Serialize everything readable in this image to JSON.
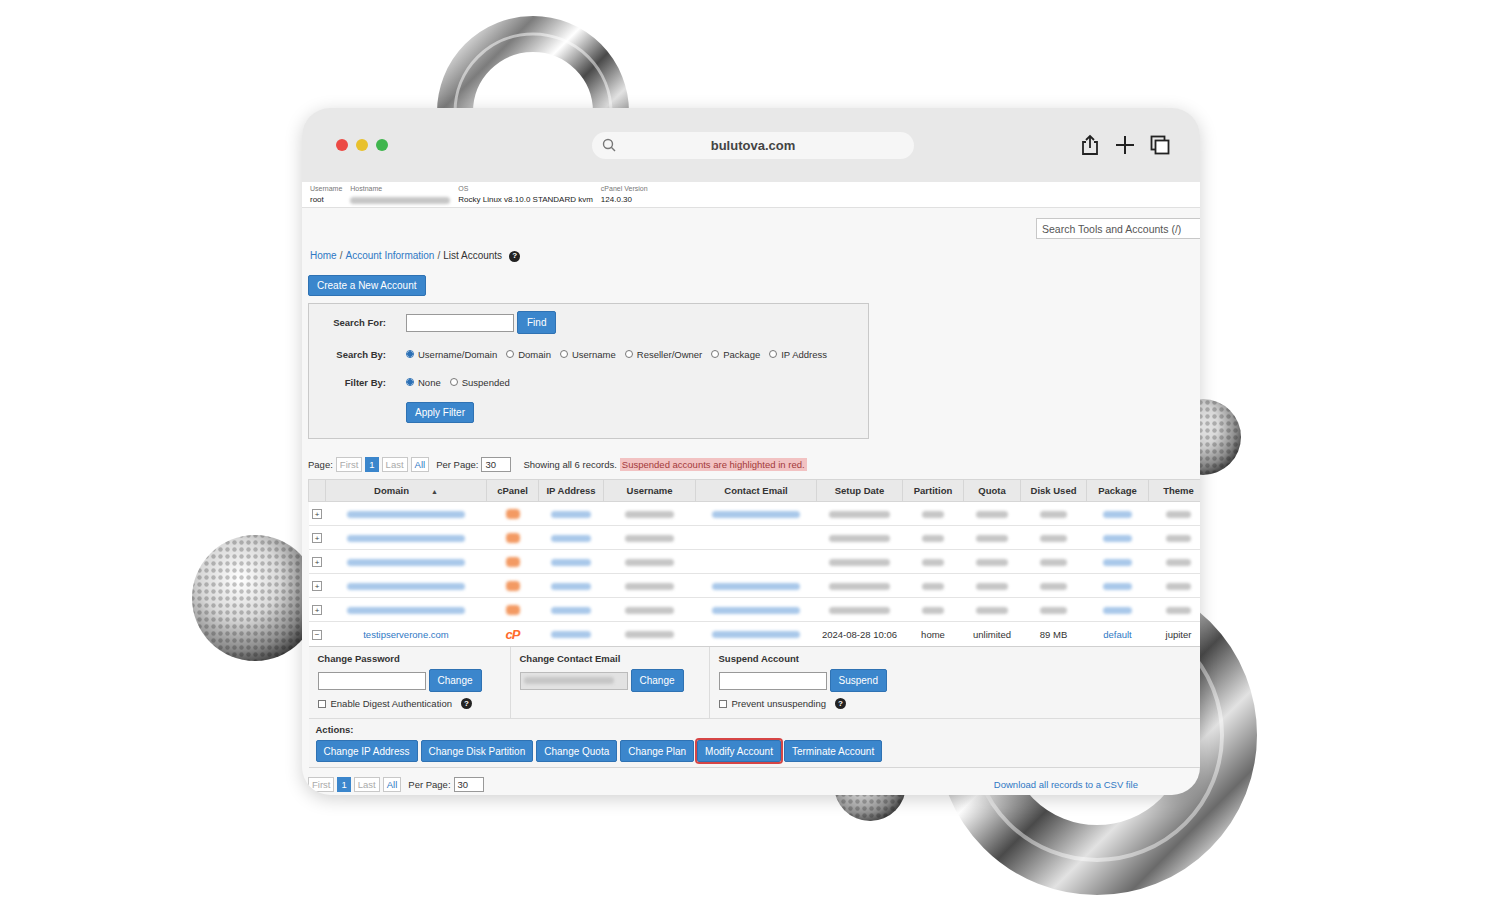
{
  "browser": {
    "url": "bulutova.com"
  },
  "info": [
    {
      "label": "Username",
      "value": "root",
      "blurred": false
    },
    {
      "label": "Hostname",
      "value": "",
      "blurred": true
    },
    {
      "label": "OS",
      "value": "Rocky Linux v8.10.0 STANDARD kvm",
      "blurred": false
    },
    {
      "label": "cPanel Version",
      "value": "124.0.30",
      "blurred": false
    }
  ],
  "global_search": {
    "placeholder": "Search Tools and Accounts (/)",
    "value": ""
  },
  "breadcrumb": {
    "separator": "/",
    "help_icon": "?",
    "items": [
      {
        "label": "Home",
        "link": true
      },
      {
        "label": "Account Information",
        "link": true
      },
      {
        "label": "List Accounts",
        "link": false
      }
    ]
  },
  "create_button": "Create a New Account",
  "search_panel": {
    "search_for_label": "Search For:",
    "search_value": "",
    "find_button": "Find",
    "search_by_label": "Search By:",
    "search_by": [
      {
        "label": "Username/Domain",
        "selected": true
      },
      {
        "label": "Domain",
        "selected": false
      },
      {
        "label": "Username",
        "selected": false
      },
      {
        "label": "Reseller/Owner",
        "selected": false
      },
      {
        "label": "Package",
        "selected": false
      },
      {
        "label": "IP Address",
        "selected": false
      }
    ],
    "filter_by_label": "Filter By:",
    "filter_by": [
      {
        "label": "None",
        "selected": true
      },
      {
        "label": "Suspended",
        "selected": false
      }
    ],
    "apply_button": "Apply Filter"
  },
  "pagination": {
    "page_label": "Page:",
    "pages": [
      {
        "label": "First",
        "selected": false,
        "disabled": true
      },
      {
        "label": "1",
        "selected": true,
        "disabled": false
      },
      {
        "label": "Last",
        "selected": false,
        "disabled": true
      },
      {
        "label": "All",
        "selected": false,
        "disabled": false
      }
    ],
    "per_page_label": "Per Page:",
    "per_page": "30",
    "summary": "Showing all 6 records.",
    "suspended_note": "Suspended accounts are highlighted in red."
  },
  "table": {
    "columns": [
      {
        "label": "Domain",
        "sorted": true,
        "sort_icon": "▲"
      },
      {
        "label": "cPanel",
        "sorted": false
      },
      {
        "label": "IP Address",
        "sorted": false
      },
      {
        "label": "Username",
        "sorted": false
      },
      {
        "label": "Contact Email",
        "sorted": false
      },
      {
        "label": "Setup Date",
        "sorted": false
      },
      {
        "label": "Partition",
        "sorted": false
      },
      {
        "label": "Quota",
        "sorted": false
      },
      {
        "label": "Disk Used",
        "sorted": false
      },
      {
        "label": "Package",
        "sorted": false
      },
      {
        "label": "Theme",
        "sorted": false
      }
    ],
    "rows": [
      {
        "expanded": false,
        "expand_icon": "+",
        "cells": [
          {
            "kind": "link",
            "text": "",
            "blurred": true
          },
          {
            "kind": "logo",
            "text": "",
            "blurred": true
          },
          {
            "kind": "link",
            "text": "",
            "blurred": true
          },
          {
            "kind": "text",
            "text": "",
            "blurred": true
          },
          {
            "kind": "link",
            "text": "",
            "blurred": true
          },
          {
            "kind": "text",
            "text": "",
            "blurred": true
          },
          {
            "kind": "text",
            "text": "",
            "blurred": true
          },
          {
            "kind": "text",
            "text": "",
            "blurred": true
          },
          {
            "kind": "text",
            "text": "",
            "blurred": true
          },
          {
            "kind": "link",
            "text": "",
            "blurred": true
          },
          {
            "kind": "text",
            "text": "",
            "blurred": true
          }
        ]
      },
      {
        "expanded": false,
        "expand_icon": "+",
        "cells": [
          {
            "kind": "link",
            "text": "",
            "blurred": true
          },
          {
            "kind": "logo",
            "text": "",
            "blurred": true
          },
          {
            "kind": "link",
            "text": "",
            "blurred": true
          },
          {
            "kind": "text",
            "text": "",
            "blurred": true
          },
          {
            "kind": "empty",
            "text": "",
            "blurred": false
          },
          {
            "kind": "text",
            "text": "",
            "blurred": true
          },
          {
            "kind": "text",
            "text": "",
            "blurred": true
          },
          {
            "kind": "text",
            "text": "",
            "blurred": true
          },
          {
            "kind": "text",
            "text": "",
            "blurred": true
          },
          {
            "kind": "link",
            "text": "",
            "blurred": true
          },
          {
            "kind": "text",
            "text": "",
            "blurred": true
          }
        ]
      },
      {
        "expanded": false,
        "expand_icon": "+",
        "cells": [
          {
            "kind": "link",
            "text": "",
            "blurred": true
          },
          {
            "kind": "logo",
            "text": "",
            "blurred": true
          },
          {
            "kind": "link",
            "text": "",
            "blurred": true
          },
          {
            "kind": "text",
            "text": "",
            "blurred": true
          },
          {
            "kind": "empty",
            "text": "",
            "blurred": false
          },
          {
            "kind": "text",
            "text": "",
            "blurred": true
          },
          {
            "kind": "text",
            "text": "",
            "blurred": true
          },
          {
            "kind": "text",
            "text": "",
            "blurred": true
          },
          {
            "kind": "text",
            "text": "",
            "blurred": true
          },
          {
            "kind": "link",
            "text": "",
            "blurred": true
          },
          {
            "kind": "text",
            "text": "",
            "blurred": true
          }
        ]
      },
      {
        "expanded": false,
        "expand_icon": "+",
        "cells": [
          {
            "kind": "link",
            "text": "",
            "blurred": true
          },
          {
            "kind": "logo",
            "text": "",
            "blurred": true
          },
          {
            "kind": "link",
            "text": "",
            "blurred": true
          },
          {
            "kind": "text",
            "text": "",
            "blurred": true
          },
          {
            "kind": "link",
            "text": "",
            "blurred": true
          },
          {
            "kind": "text",
            "text": "",
            "blurred": true
          },
          {
            "kind": "text",
            "text": "",
            "blurred": true
          },
          {
            "kind": "text",
            "text": "",
            "blurred": true
          },
          {
            "kind": "text",
            "text": "",
            "blurred": true
          },
          {
            "kind": "link",
            "text": "",
            "blurred": true
          },
          {
            "kind": "text",
            "text": "",
            "blurred": true
          }
        ]
      },
      {
        "expanded": false,
        "expand_icon": "+",
        "cells": [
          {
            "kind": "link",
            "text": "",
            "blurred": true
          },
          {
            "kind": "logo",
            "text": "",
            "blurred": true
          },
          {
            "kind": "link",
            "text": "",
            "blurred": true
          },
          {
            "kind": "text",
            "text": "",
            "blurred": true
          },
          {
            "kind": "link",
            "text": "",
            "blurred": true
          },
          {
            "kind": "text",
            "text": "",
            "blurred": true
          },
          {
            "kind": "text",
            "text": "",
            "blurred": true
          },
          {
            "kind": "text",
            "text": "",
            "blurred": true
          },
          {
            "kind": "text",
            "text": "",
            "blurred": true
          },
          {
            "kind": "link",
            "text": "",
            "blurred": true
          },
          {
            "kind": "text",
            "text": "",
            "blurred": true
          }
        ]
      },
      {
        "expanded": true,
        "expand_icon": "−",
        "cells": [
          {
            "kind": "link",
            "text": "testipserverone.com",
            "blurred": false
          },
          {
            "kind": "logo",
            "text": "cP",
            "blurred": false
          },
          {
            "kind": "link",
            "text": "",
            "blurred": true
          },
          {
            "kind": "text",
            "text": "",
            "blurred": true
          },
          {
            "kind": "link",
            "text": "",
            "blurred": true
          },
          {
            "kind": "text",
            "text": "2024-08-28 10:06",
            "blurred": false
          },
          {
            "kind": "text",
            "text": "home",
            "blurred": false
          },
          {
            "kind": "text",
            "text": "unlimited",
            "blurred": false
          },
          {
            "kind": "text",
            "text": "89 MB",
            "blurred": false
          },
          {
            "kind": "link",
            "text": "default",
            "blurred": false
          },
          {
            "kind": "text",
            "text": "jupiter",
            "blurred": false
          }
        ]
      }
    ]
  },
  "account_panel": {
    "sections": [
      {
        "title": "Change Password",
        "input": "",
        "input_blurred": false,
        "button": "Change",
        "checkbox": {
          "label": "Enable Digest Authentication",
          "checked": false,
          "help_icon": "?"
        }
      },
      {
        "title": "Change Contact Email",
        "input": "",
        "input_blurred": true,
        "button": "Change",
        "checkbox": null
      },
      {
        "title": "Suspend Account",
        "input": "",
        "input_blurred": false,
        "button": "Suspend",
        "checkbox": {
          "label": "Prevent unsuspending",
          "checked": false,
          "help_icon": "?"
        }
      }
    ],
    "actions_label": "Actions:",
    "actions": [
      {
        "label": "Change IP Address",
        "highlighted": false
      },
      {
        "label": "Change Disk Partition",
        "highlighted": false
      },
      {
        "label": "Change Quota",
        "highlighted": false
      },
      {
        "label": "Change Plan",
        "highlighted": false
      },
      {
        "label": "Modify Account",
        "highlighted": true
      },
      {
        "label": "Terminate Account",
        "highlighted": false
      }
    ]
  },
  "footer": {
    "pages": [
      {
        "label": "First",
        "selected": false,
        "disabled": true
      },
      {
        "label": "1",
        "selected": true,
        "disabled": false
      },
      {
        "label": "Last",
        "selected": false,
        "disabled": true
      },
      {
        "label": "All",
        "selected": false,
        "disabled": false
      }
    ],
    "per_page_label": "Per Page:",
    "per_page": "30",
    "csv_link": "Download all records to a CSV file"
  }
}
